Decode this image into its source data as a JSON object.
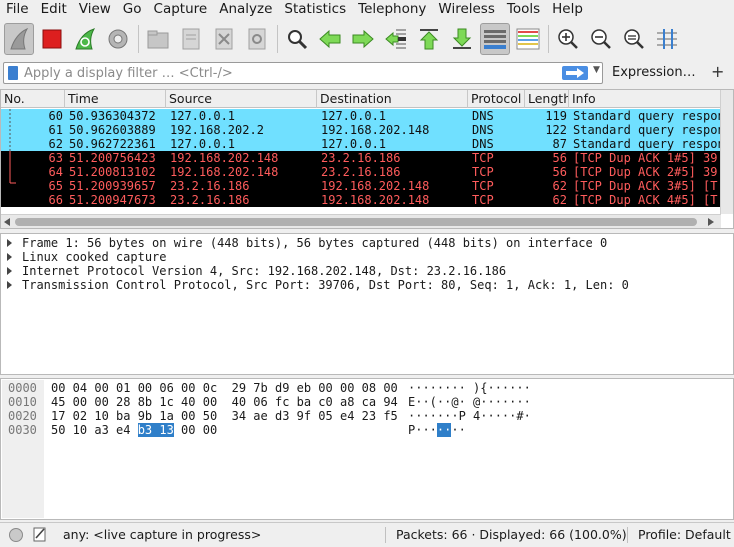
{
  "menu": [
    "File",
    "Edit",
    "View",
    "Go",
    "Capture",
    "Analyze",
    "Statistics",
    "Telephony",
    "Wireless",
    "Tools",
    "Help"
  ],
  "toolbar_icons": [
    "shark-fin-start-icon",
    "stop-capture-icon",
    "restart-capture-icon",
    "capture-options-icon",
    "open-file-icon",
    "save-file-icon",
    "close-file-icon",
    "reload-file-icon",
    "find-packet-icon",
    "go-back-icon",
    "go-forward-icon",
    "go-to-packet-icon",
    "first-packet-icon",
    "last-packet-icon",
    "autoscroll-icon",
    "colorize-icon",
    "zoom-in-icon",
    "zoom-out-icon",
    "normal-size-icon",
    "resize-columns-icon"
  ],
  "filter": {
    "placeholder": "Apply a display filter … <Ctrl-/>",
    "expression_label": "Expression…",
    "add_label": "+"
  },
  "packet_list": {
    "columns": [
      "No.",
      "Time",
      "Source",
      "Destination",
      "Protocol",
      "Length",
      "Info"
    ],
    "rows": [
      {
        "no": "60",
        "time": "50.936304372",
        "src": "127.0.0.1",
        "dst": "127.0.0.1",
        "proto": "DNS",
        "len": "119",
        "info": "Standard query response",
        "style": "dns"
      },
      {
        "no": "61",
        "time": "50.962603889",
        "src": "192.168.202.2",
        "dst": "192.168.202.148",
        "proto": "DNS",
        "len": "122",
        "info": "Standard query response",
        "style": "dns"
      },
      {
        "no": "62",
        "time": "50.962722361",
        "src": "127.0.0.1",
        "dst": "127.0.0.1",
        "proto": "DNS",
        "len": "87",
        "info": "Standard query response",
        "style": "dns"
      },
      {
        "no": "63",
        "time": "51.200756423",
        "src": "192.168.202.148",
        "dst": "23.2.16.186",
        "proto": "TCP",
        "len": "56",
        "info": "[TCP Dup ACK 1#5] 39",
        "style": "bad"
      },
      {
        "no": "64",
        "time": "51.200813102",
        "src": "192.168.202.148",
        "dst": "23.2.16.186",
        "proto": "TCP",
        "len": "56",
        "info": "[TCP Dup ACK 2#5] 39",
        "style": "bad"
      },
      {
        "no": "65",
        "time": "51.200939657",
        "src": "23.2.16.186",
        "dst": "192.168.202.148",
        "proto": "TCP",
        "len": "62",
        "info": "[TCP Dup ACK 3#5] [T",
        "style": "bad"
      },
      {
        "no": "66",
        "time": "51.200947673",
        "src": "23.2.16.186",
        "dst": "192.168.202.148",
        "proto": "TCP",
        "len": "62",
        "info": "[TCP Dup ACK 4#5] [T",
        "style": "bad"
      }
    ]
  },
  "details": [
    "Frame 1: 56 bytes on wire (448 bits), 56 bytes captured (448 bits) on interface 0",
    "Linux cooked capture",
    "Internet Protocol Version 4, Src: 192.168.202.148, Dst: 23.2.16.186",
    "Transmission Control Protocol, Src Port: 39706, Dst Port: 80, Seq: 1, Ack: 1, Len: 0"
  ],
  "bytes": {
    "rows": [
      {
        "offset": "0000",
        "hex_a": "00 04 00 01 00 06 00 0c  29 7b d9 eb 00 00 08 00",
        "hex_hl": "",
        "hex_b": "",
        "ascii_a": "········ ){······",
        "ascii_hl": "",
        "ascii_b": ""
      },
      {
        "offset": "0010",
        "hex_a": "45 00 00 28 8b 1c 40 00  40 06 fc ba c0 a8 ca 94",
        "hex_hl": "",
        "hex_b": "",
        "ascii_a": "E··(··@· @·······",
        "ascii_hl": "",
        "ascii_b": ""
      },
      {
        "offset": "0020",
        "hex_a": "17 02 10 ba 9b 1a 00 50  34 ae d3 9f 05 e4 23 f5",
        "hex_hl": "",
        "hex_b": "",
        "ascii_a": "·······P 4·····#·",
        "ascii_hl": "",
        "ascii_b": ""
      },
      {
        "offset": "0030",
        "hex_a": "50 10 a3 e4 ",
        "hex_hl": "b3 13",
        "hex_b": " 00 00",
        "ascii_a": "P···",
        "ascii_hl": "··",
        "ascii_b": "··"
      }
    ]
  },
  "status": {
    "capture": "any: <live capture in progress>",
    "packets": "Packets: 66 · Displayed: 66 (100.0%)",
    "profile": "Profile: Default"
  },
  "colors": {
    "dns_bg": "#70e0ff",
    "bad_bg": "#000000",
    "bad_fg": "#ff5c5c",
    "highlight": "#2f7fc9"
  }
}
